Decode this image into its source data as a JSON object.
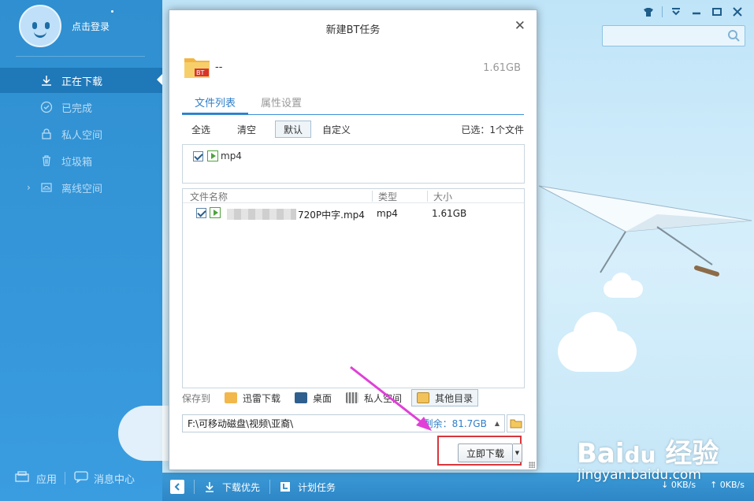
{
  "sidebar": {
    "login": "点击登录",
    "items": [
      {
        "label": "正在下载",
        "icon": "download-arrow-icon",
        "active": true
      },
      {
        "label": "已完成",
        "icon": "check-circle-icon",
        "active": false
      },
      {
        "label": "私人空间",
        "icon": "lock-icon",
        "active": false
      },
      {
        "label": "垃圾箱",
        "icon": "trash-icon",
        "active": false
      },
      {
        "label": "离线空间",
        "icon": "cloud-icon",
        "active": false
      }
    ],
    "bottom": {
      "apps": "应用",
      "messages": "消息中心"
    }
  },
  "statusbar": {
    "download_first": "下载优先",
    "scheduled": "计划任务",
    "down_speed": "0KB/s",
    "up_speed": "0KB/s"
  },
  "dialog": {
    "title": "新建BT任务",
    "task_name": "--",
    "task_size": "1.61GB",
    "tabs": [
      "文件列表",
      "属性设置"
    ],
    "filters": [
      "全选",
      "清空",
      "默认",
      "自定义"
    ],
    "active_filter": "默认",
    "selected_info": "已选：1个文件",
    "type_filter": "mp4",
    "table": {
      "headers": [
        "文件名称",
        "类型",
        "大小"
      ],
      "rows": [
        {
          "name": "720P中字.mp4",
          "type": "mp4",
          "size": "1.61GB",
          "checked": true
        }
      ]
    },
    "save_to_label": "保存到",
    "locations": [
      "迅雷下载",
      "桌面",
      "私人空间",
      "其他目录"
    ],
    "active_location": "其他目录",
    "path": "F:\\可移动磁盘\\视频\\亚裔\\",
    "free_space": "剩余：81.7GB",
    "download_now": "立即下载"
  },
  "watermark": {
    "brand": "Bai 经验",
    "url": "jingyan.baidu.com"
  },
  "colors": {
    "accent": "#2f7fc9",
    "sidebar": "#2f8fd0",
    "highlight_box": "#d8363b",
    "arrow": "#e040d8"
  }
}
